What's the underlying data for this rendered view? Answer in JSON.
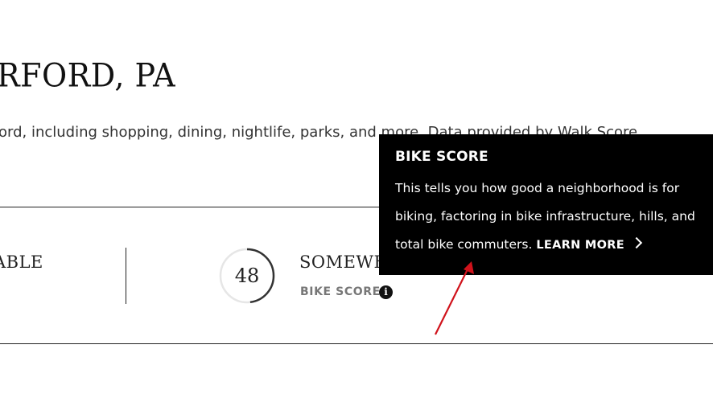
{
  "page": {
    "heading": "RFORD, PA",
    "description": "ord, including shopping, dining, nightlife, parks, and more. Data provided by Walk Score."
  },
  "scores": {
    "left_label": "ABLE",
    "bike": {
      "value": "48",
      "fraction": 0.48,
      "description": "SOMEWH",
      "label": "BIKE SCORE",
      "info_glyph": "i"
    }
  },
  "tooltip": {
    "title": "BIKE SCORE",
    "body": "This tells you how good a neighborhood is for biking, factoring in bike infrastructure, hills, and total bike commuters.",
    "link": "LEARN MORE"
  },
  "colors": {
    "tooltip_bg": "#000000",
    "gauge_track": "#e6e6e6",
    "gauge_fill": "#333333",
    "annotation_arrow": "#d0121b"
  },
  "icons": {
    "info": "info-circle-icon",
    "link_chevron": "chevron-right-icon"
  }
}
